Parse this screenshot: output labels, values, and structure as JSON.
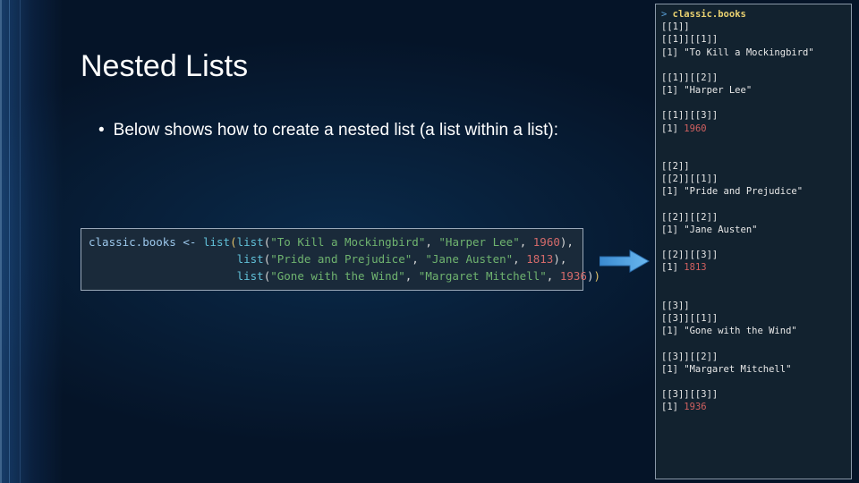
{
  "title": "Nested Lists",
  "bullet": "•",
  "body": "Below shows how to create a nested list (a list within a list):",
  "code": {
    "var": "classic.books",
    "assign": "<-",
    "fn": "list",
    "books": [
      {
        "title": "\"To Kill a Mockingbird\"",
        "author": "\"Harper Lee\"",
        "year": "1960"
      },
      {
        "title": "\"Pride and Prejudice\"",
        "author": "\"Jane Austen\"",
        "year": "1813"
      },
      {
        "title": "\"Gone with the Wind\"",
        "author": "\"Margaret Mitchell\"",
        "year": "1936"
      }
    ]
  },
  "output": {
    "prompt": ">",
    "command": "classic.books",
    "groups": [
      {
        "outer": "[[1]]",
        "items": [
          {
            "idx": "[[1]][[1]]",
            "val": "[1] \"To Kill a Mockingbird\""
          },
          {
            "idx": "[[1]][[2]]",
            "val": "[1] \"Harper Lee\""
          },
          {
            "idx": "[[1]][[3]]",
            "val": "[1] 1960",
            "num": true
          }
        ]
      },
      {
        "outer": "[[2]]",
        "items": [
          {
            "idx": "[[2]][[1]]",
            "val": "[1] \"Pride and Prejudice\""
          },
          {
            "idx": "[[2]][[2]]",
            "val": "[1] \"Jane Austen\""
          },
          {
            "idx": "[[2]][[3]]",
            "val": "[1] 1813",
            "num": true
          }
        ]
      },
      {
        "outer": "[[3]]",
        "items": [
          {
            "idx": "[[3]][[1]]",
            "val": "[1] \"Gone with the Wind\""
          },
          {
            "idx": "[[3]][[2]]",
            "val": "[1] \"Margaret Mitchell\""
          },
          {
            "idx": "[[3]][[3]]",
            "val": "[1] 1936",
            "num": true
          }
        ]
      }
    ]
  }
}
